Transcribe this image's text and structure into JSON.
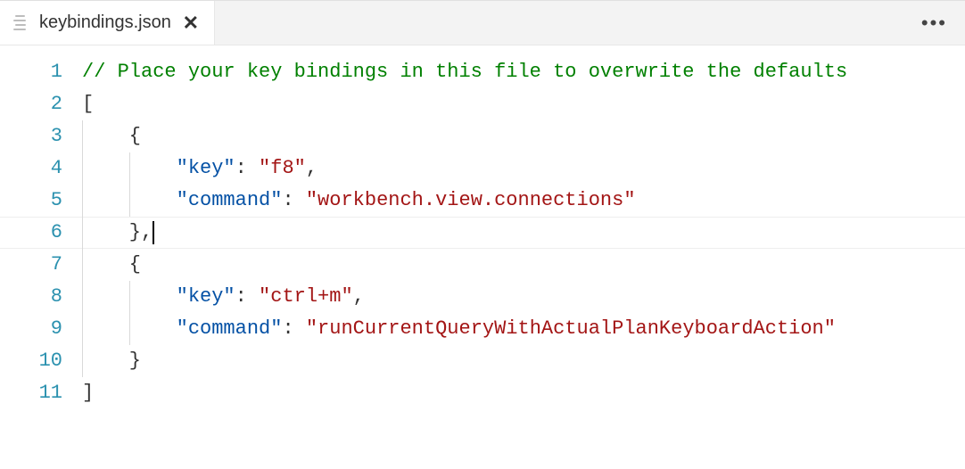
{
  "tab": {
    "filename": "keybindings.json",
    "close_label": "✕",
    "overflow_label": "•••"
  },
  "editor": {
    "active_line": 6,
    "lines": [
      {
        "num": "1",
        "tokens": [
          {
            "t": "// Place your key bindings in this file to overwrite the defaults",
            "c": "comment"
          }
        ],
        "indent": 0
      },
      {
        "num": "2",
        "tokens": [
          {
            "t": "[",
            "c": "punct"
          }
        ],
        "indent": 0
      },
      {
        "num": "3",
        "tokens": [
          {
            "t": "    {",
            "c": "punct"
          }
        ],
        "indent": 1
      },
      {
        "num": "4",
        "tokens": [
          {
            "t": "        ",
            "c": "punct"
          },
          {
            "t": "\"key\"",
            "c": "prop"
          },
          {
            "t": ": ",
            "c": "punct"
          },
          {
            "t": "\"f8\"",
            "c": "string"
          },
          {
            "t": ",",
            "c": "punct"
          }
        ],
        "indent": 2
      },
      {
        "num": "5",
        "tokens": [
          {
            "t": "        ",
            "c": "punct"
          },
          {
            "t": "\"command\"",
            "c": "prop"
          },
          {
            "t": ": ",
            "c": "punct"
          },
          {
            "t": "\"workbench.view.connections\"",
            "c": "string"
          }
        ],
        "indent": 2
      },
      {
        "num": "6",
        "tokens": [
          {
            "t": "    },",
            "c": "punct"
          }
        ],
        "indent": 1,
        "cursor_after": true
      },
      {
        "num": "7",
        "tokens": [
          {
            "t": "    {",
            "c": "punct"
          }
        ],
        "indent": 1
      },
      {
        "num": "8",
        "tokens": [
          {
            "t": "        ",
            "c": "punct"
          },
          {
            "t": "\"key\"",
            "c": "prop"
          },
          {
            "t": ": ",
            "c": "punct"
          },
          {
            "t": "\"ctrl+m\"",
            "c": "string"
          },
          {
            "t": ",",
            "c": "punct"
          }
        ],
        "indent": 2
      },
      {
        "num": "9",
        "tokens": [
          {
            "t": "        ",
            "c": "punct"
          },
          {
            "t": "\"command\"",
            "c": "prop"
          },
          {
            "t": ": ",
            "c": "punct"
          },
          {
            "t": "\"runCurrentQueryWithActualPlanKeyboardAction\"",
            "c": "string"
          }
        ],
        "indent": 2
      },
      {
        "num": "10",
        "tokens": [
          {
            "t": "    }",
            "c": "punct"
          }
        ],
        "indent": 1
      },
      {
        "num": "11",
        "tokens": [
          {
            "t": "]",
            "c": "punct"
          }
        ],
        "indent": 0
      }
    ]
  }
}
